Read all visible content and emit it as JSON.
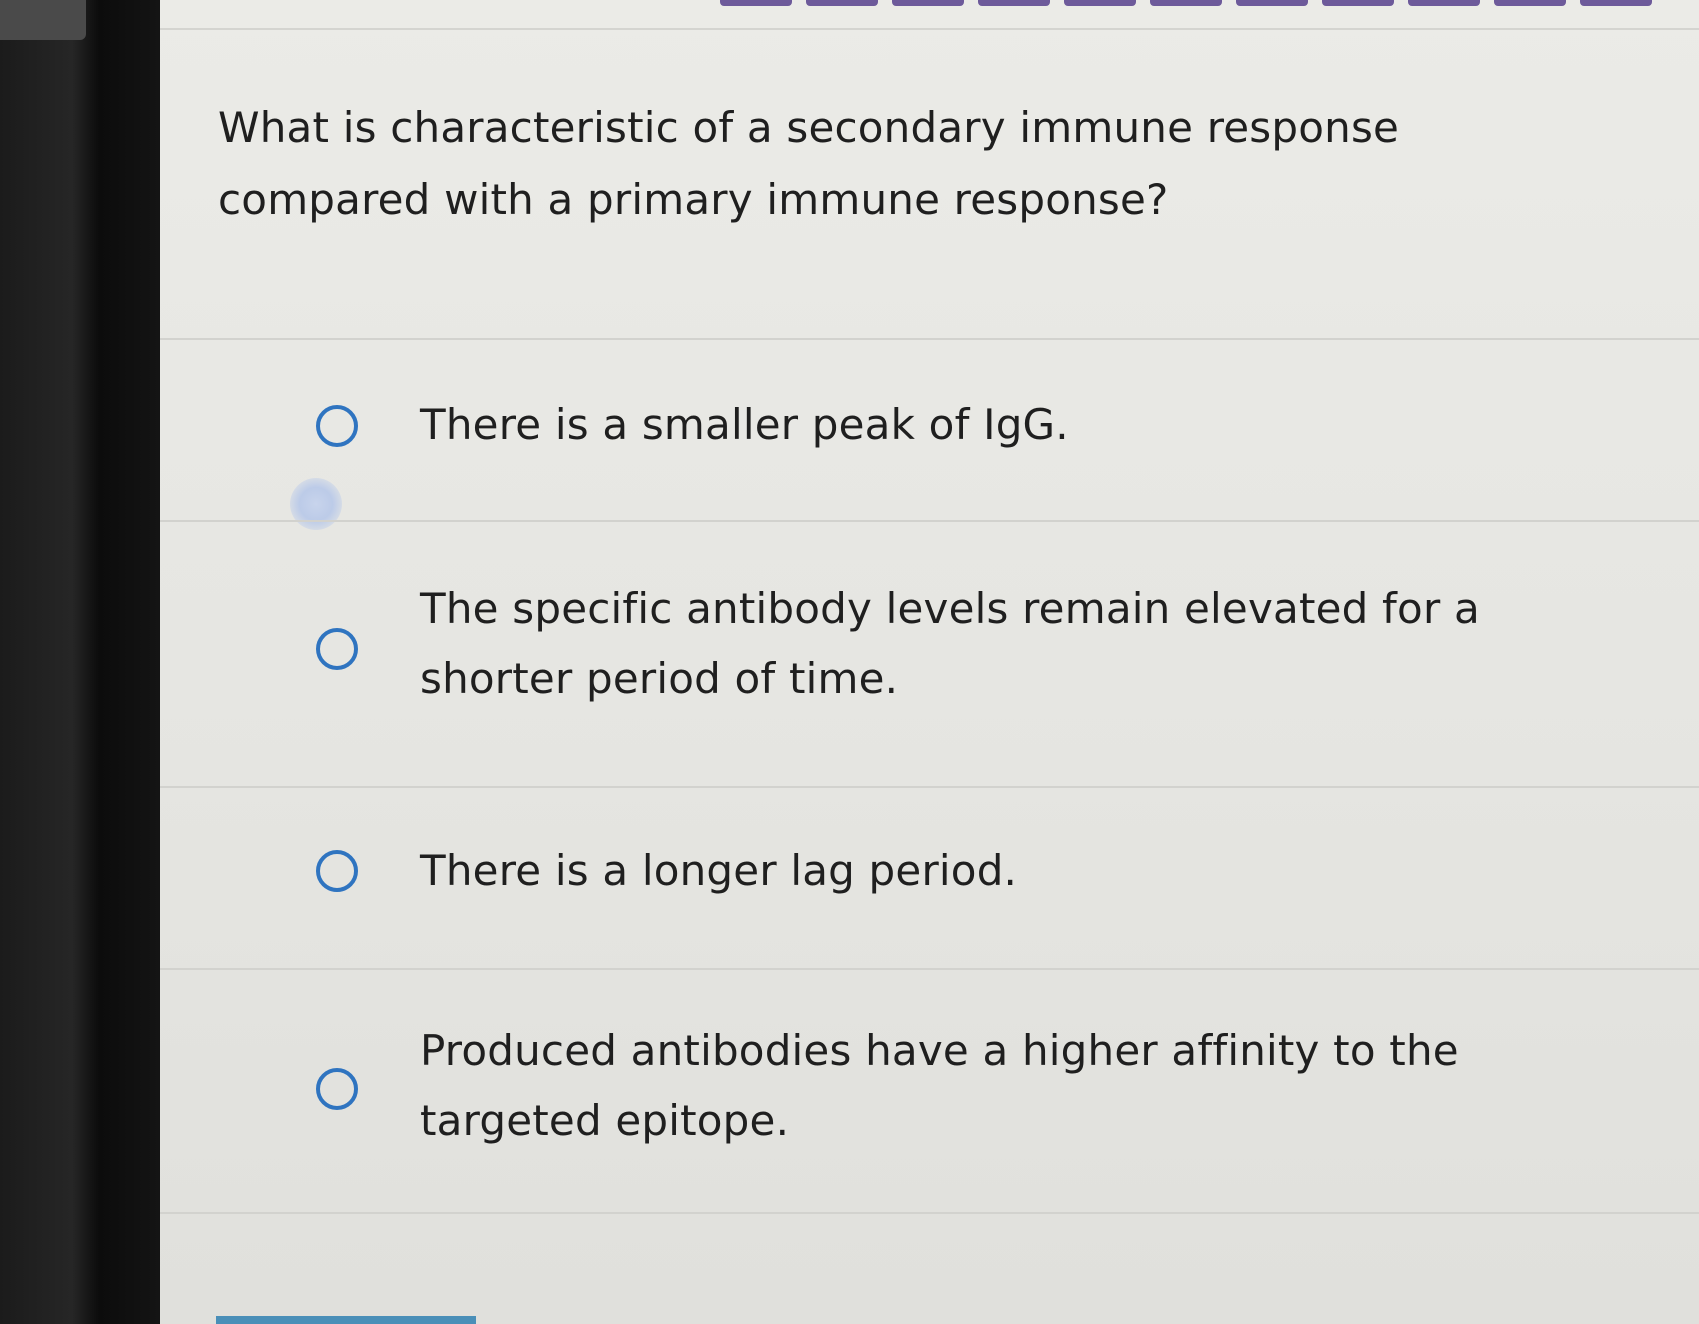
{
  "question": {
    "text": "What is characteristic of a secondary immune response compared with a primary immune response?"
  },
  "options": [
    {
      "label": "There is a smaller peak of IgG.",
      "selected": false
    },
    {
      "label": "The specific antibody levels remain elevated for a shorter period of time.",
      "selected": false
    },
    {
      "label": "There is a longer lag period.",
      "selected": false
    },
    {
      "label": "Produced antibodies have a higher affinity to the targeted epitope.",
      "selected": false
    }
  ],
  "colors": {
    "radio_border": "#2f74c0",
    "nav_accent": "#6d5a9a",
    "text": "#1f1f1f"
  }
}
